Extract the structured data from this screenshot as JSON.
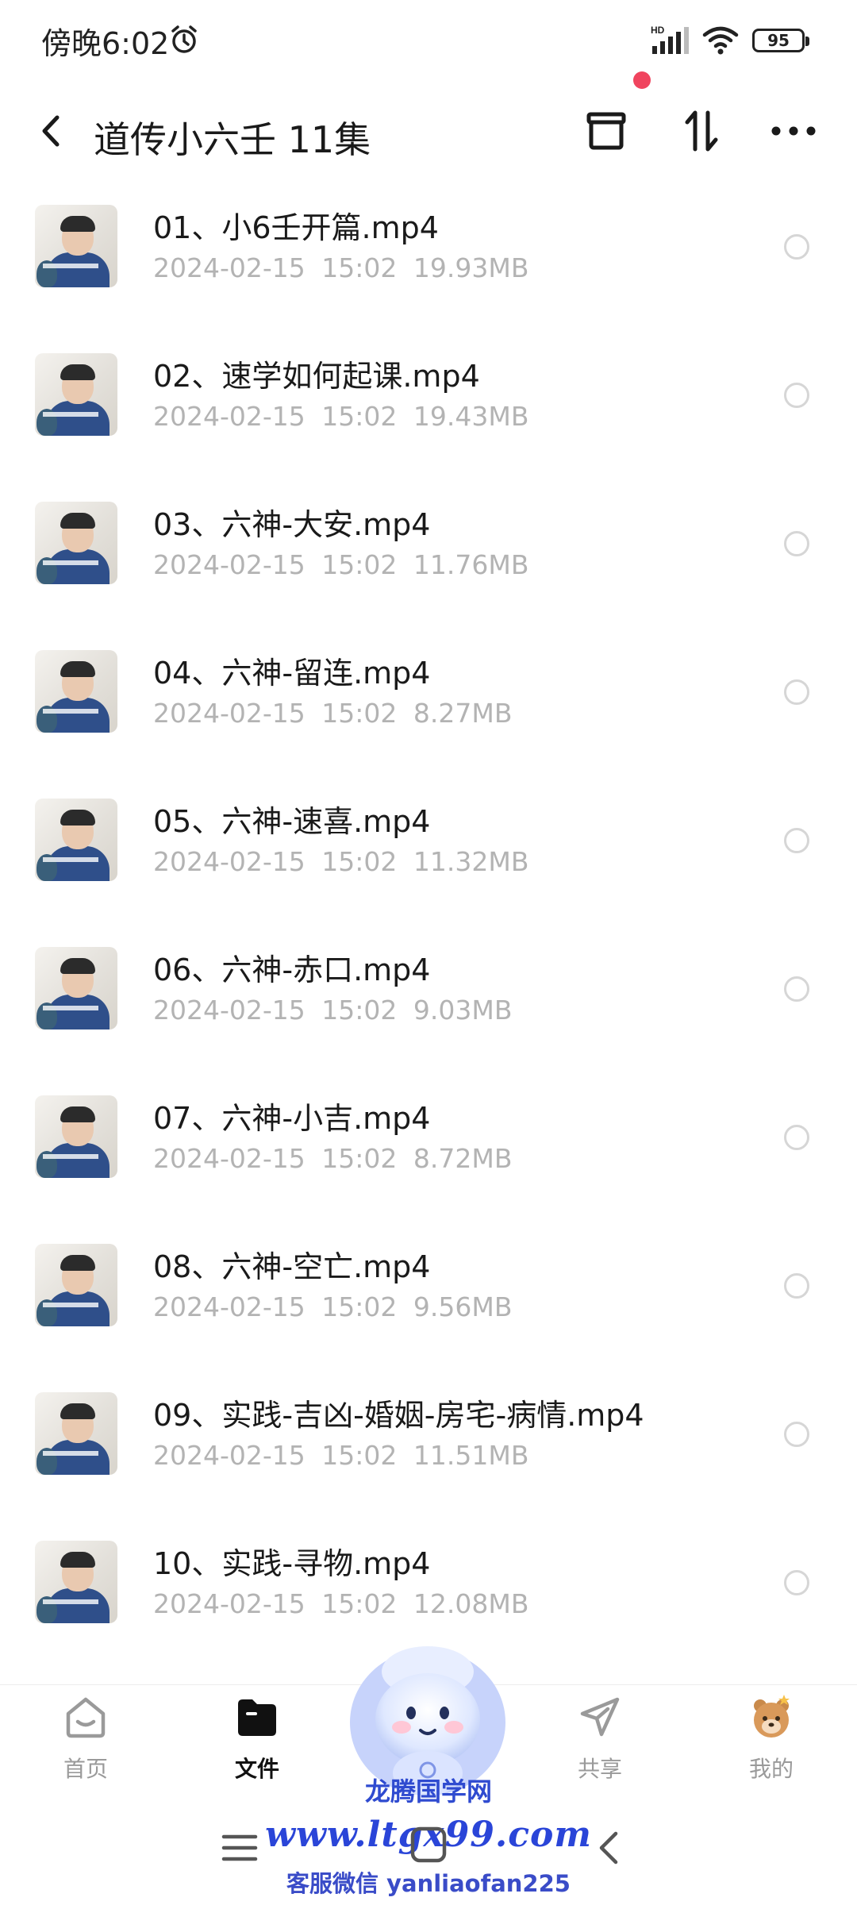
{
  "status_bar": {
    "time": "傍晚6:02",
    "network": "HD",
    "battery": "95"
  },
  "header": {
    "title": "道传小六壬 11集"
  },
  "files": [
    {
      "name": "01、小6壬开篇.mp4",
      "date": "2024-02-15",
      "time": "15:02",
      "size": "19.93MB"
    },
    {
      "name": "02、速学如何起课.mp4",
      "date": "2024-02-15",
      "time": "15:02",
      "size": "19.43MB"
    },
    {
      "name": "03、六神-大安.mp4",
      "date": "2024-02-15",
      "time": "15:02",
      "size": "11.76MB"
    },
    {
      "name": "04、六神-留连.mp4",
      "date": "2024-02-15",
      "time": "15:02",
      "size": "8.27MB"
    },
    {
      "name": "05、六神-速喜.mp4",
      "date": "2024-02-15",
      "time": "15:02",
      "size": "11.32MB"
    },
    {
      "name": "06、六神-赤口.mp4",
      "date": "2024-02-15",
      "time": "15:02",
      "size": "9.03MB"
    },
    {
      "name": "07、六神-小吉.mp4",
      "date": "2024-02-15",
      "time": "15:02",
      "size": "8.72MB"
    },
    {
      "name": "08、六神-空亡.mp4",
      "date": "2024-02-15",
      "time": "15:02",
      "size": "9.56MB"
    },
    {
      "name": "09、实践-吉凶-婚姻-房宅-病情.mp4",
      "date": "2024-02-15",
      "time": "15:02",
      "size": "11.51MB"
    },
    {
      "name": "10、实践-寻物.mp4",
      "date": "2024-02-15",
      "time": "15:02",
      "size": "12.08MB"
    }
  ],
  "bottom_nav": [
    {
      "label": "首页",
      "icon": "home-icon",
      "active": false
    },
    {
      "label": "文件",
      "icon": "folder-icon",
      "active": true
    },
    {
      "label": "共享",
      "icon": "share-icon",
      "active": false
    },
    {
      "label": "我的",
      "icon": "profile-icon",
      "active": false
    }
  ],
  "watermark": {
    "name": "龙腾国学网",
    "url": "www.ltgx99.com",
    "contact": "客服微信 yanliaofan225"
  },
  "colors": {
    "accent_red": "#f0445e",
    "watermark_blue": "#2a45d8",
    "meta_gray": "#b3b3b3"
  }
}
